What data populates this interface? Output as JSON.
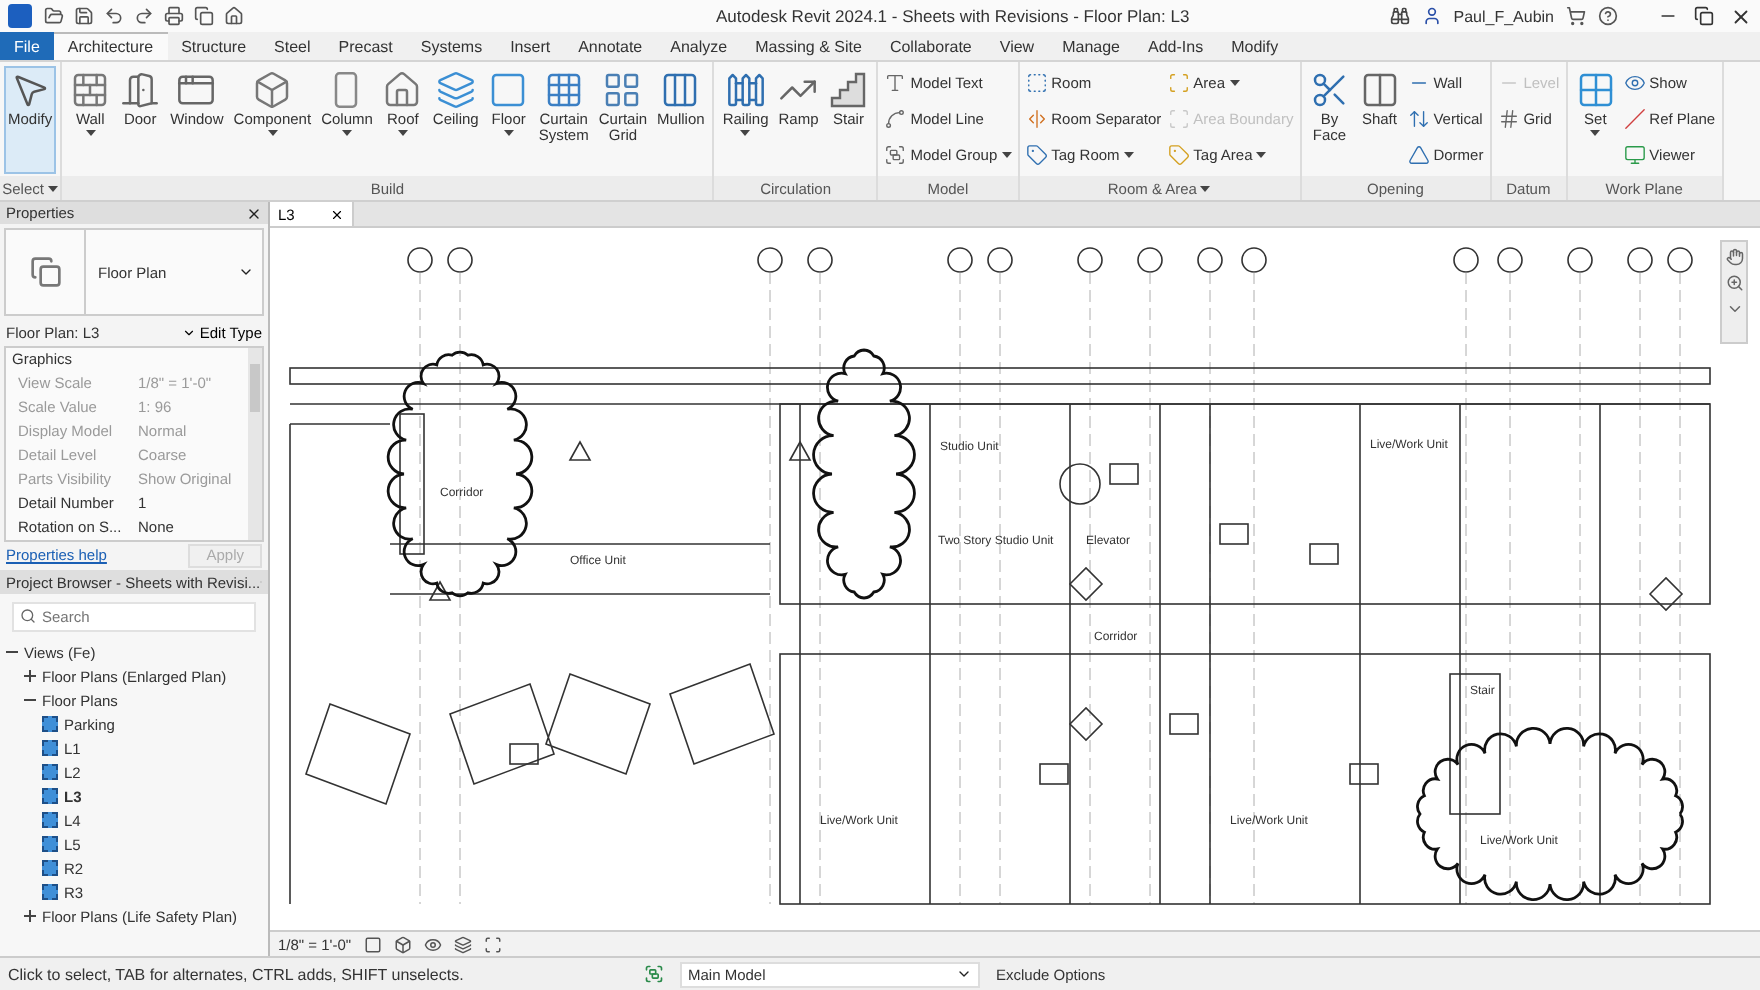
{
  "window": {
    "title": "Autodesk Revit 2024.1 - Sheets with Revisions - Floor Plan: L3",
    "user": "Paul_F_Aubin"
  },
  "tabs": [
    {
      "label": "File",
      "kind": "file",
      "selected": false
    },
    {
      "label": "Architecture",
      "kind": "tab",
      "selected": true
    },
    {
      "label": "Structure",
      "kind": "tab",
      "selected": false
    },
    {
      "label": "Steel",
      "kind": "tab",
      "selected": false
    },
    {
      "label": "Precast",
      "kind": "tab",
      "selected": false
    },
    {
      "label": "Systems",
      "kind": "tab",
      "selected": false
    },
    {
      "label": "Insert",
      "kind": "tab",
      "selected": false
    },
    {
      "label": "Annotate",
      "kind": "tab",
      "selected": false
    },
    {
      "label": "Analyze",
      "kind": "tab",
      "selected": false
    },
    {
      "label": "Massing & Site",
      "kind": "tab",
      "selected": false
    },
    {
      "label": "Collaborate",
      "kind": "tab",
      "selected": false
    },
    {
      "label": "View",
      "kind": "tab",
      "selected": false
    },
    {
      "label": "Manage",
      "kind": "tab",
      "selected": false
    },
    {
      "label": "Add-Ins",
      "kind": "tab",
      "selected": false
    },
    {
      "label": "Modify",
      "kind": "tab",
      "selected": false
    }
  ],
  "ribbon_panels": [
    {
      "label": "Select",
      "dropdown": true,
      "tools": [
        {
          "label": "Modify",
          "kind": "large",
          "selected": true,
          "disabled": false,
          "dropdown": false
        }
      ]
    },
    {
      "label": "Build",
      "dropdown": false,
      "tools": [
        {
          "label": "Wall",
          "kind": "large",
          "selected": false,
          "disabled": false,
          "dropdown": true
        },
        {
          "label": "Door",
          "kind": "large",
          "selected": false,
          "disabled": false,
          "dropdown": false
        },
        {
          "label": "Window",
          "kind": "large",
          "selected": false,
          "disabled": false,
          "dropdown": false
        },
        {
          "label": "Component",
          "kind": "large",
          "selected": false,
          "disabled": false,
          "dropdown": true
        },
        {
          "label": "Column",
          "kind": "large",
          "selected": false,
          "disabled": false,
          "dropdown": true
        },
        {
          "label": "Roof",
          "kind": "large",
          "selected": false,
          "disabled": false,
          "dropdown": true
        },
        {
          "label": "Ceiling",
          "kind": "large",
          "selected": false,
          "disabled": false,
          "dropdown": false
        },
        {
          "label": "Floor",
          "kind": "large",
          "selected": false,
          "disabled": false,
          "dropdown": true
        },
        {
          "label": "Curtain System",
          "kind": "large",
          "selected": false,
          "disabled": false,
          "dropdown": false
        },
        {
          "label": "Curtain Grid",
          "kind": "large",
          "selected": false,
          "disabled": false,
          "dropdown": false
        },
        {
          "label": "Mullion",
          "kind": "large",
          "selected": false,
          "disabled": false,
          "dropdown": false
        }
      ]
    },
    {
      "label": "Circulation",
      "dropdown": false,
      "tools": [
        {
          "label": "Railing",
          "kind": "large",
          "selected": false,
          "disabled": false,
          "dropdown": true
        },
        {
          "label": "Ramp",
          "kind": "large",
          "selected": false,
          "disabled": false,
          "dropdown": false
        },
        {
          "label": "Stair",
          "kind": "large",
          "selected": false,
          "disabled": false,
          "dropdown": false
        }
      ]
    },
    {
      "label": "Model",
      "dropdown": false,
      "tools": [
        {
          "label": "Model Text",
          "kind": "small",
          "selected": false,
          "disabled": false,
          "dropdown": false
        },
        {
          "label": "Model Line",
          "kind": "small",
          "selected": false,
          "disabled": false,
          "dropdown": false
        },
        {
          "label": "Model Group",
          "kind": "small",
          "selected": false,
          "disabled": false,
          "dropdown": true
        }
      ]
    },
    {
      "label": "Room & Area",
      "dropdown": true,
      "tools": [
        {
          "label": "Room",
          "kind": "small",
          "selected": false,
          "disabled": false,
          "dropdown": false
        },
        {
          "label": "Room Separator",
          "kind": "small",
          "selected": false,
          "disabled": false,
          "dropdown": false
        },
        {
          "label": "Tag Room",
          "kind": "small",
          "selected": false,
          "disabled": false,
          "dropdown": true
        },
        {
          "label": "Area",
          "kind": "small",
          "selected": false,
          "disabled": false,
          "dropdown": true
        },
        {
          "label": "Area Boundary",
          "kind": "small",
          "selected": false,
          "disabled": true,
          "dropdown": false
        },
        {
          "label": "Tag Area",
          "kind": "small",
          "selected": false,
          "disabled": false,
          "dropdown": true
        }
      ]
    },
    {
      "label": "Opening",
      "dropdown": false,
      "tools": [
        {
          "label": "By Face",
          "kind": "large",
          "selected": false,
          "disabled": false,
          "dropdown": false
        },
        {
          "label": "Shaft",
          "kind": "large",
          "selected": false,
          "disabled": false,
          "dropdown": false
        },
        {
          "label": "Wall",
          "kind": "small",
          "selected": false,
          "disabled": false,
          "dropdown": false
        },
        {
          "label": "Vertical",
          "kind": "small",
          "selected": false,
          "disabled": false,
          "dropdown": false
        },
        {
          "label": "Dormer",
          "kind": "small",
          "selected": false,
          "disabled": false,
          "dropdown": false
        }
      ]
    },
    {
      "label": "Datum",
      "dropdown": false,
      "tools": [
        {
          "label": "Level",
          "kind": "small",
          "selected": false,
          "disabled": true,
          "dropdown": false
        },
        {
          "label": "Grid",
          "kind": "small",
          "selected": false,
          "disabled": false,
          "dropdown": false
        }
      ]
    },
    {
      "label": "Work Plane",
      "dropdown": false,
      "tools": [
        {
          "label": "Set",
          "kind": "large",
          "selected": false,
          "disabled": false,
          "dropdown": true
        },
        {
          "label": "Show",
          "kind": "small",
          "selected": false,
          "disabled": false,
          "dropdown": false
        },
        {
          "label": "Ref Plane",
          "kind": "small",
          "selected": false,
          "disabled": false,
          "dropdown": false
        },
        {
          "label": "Viewer",
          "kind": "small",
          "selected": false,
          "disabled": false,
          "dropdown": false
        }
      ]
    }
  ],
  "properties": {
    "title": "Properties",
    "type": "Floor Plan",
    "instance": "Floor Plan: L3",
    "edit_type": "Edit Type",
    "group": "Graphics",
    "rows": [
      {
        "label": "View Scale",
        "value": "1/8\" = 1'-0\"",
        "disabled": true
      },
      {
        "label": "Scale Value",
        "value": "1: 96",
        "disabled": true
      },
      {
        "label": "Display Model",
        "value": "Normal",
        "disabled": true
      },
      {
        "label": "Detail Level",
        "value": "Coarse",
        "disabled": true
      },
      {
        "label": "Parts Visibility",
        "value": "Show Original",
        "disabled": true
      },
      {
        "label": "Detail Number",
        "value": "1",
        "disabled": false
      },
      {
        "label": "Rotation on S...",
        "value": "None",
        "disabled": false
      }
    ],
    "help": "Properties help",
    "apply": "Apply",
    "apply_disabled": true
  },
  "project_browser": {
    "title": "Project Browser - Sheets with Revisi...",
    "placeholder": "Search",
    "tree": [
      {
        "label": "Views (Fe)",
        "expanded": true,
        "selected": false,
        "children": [
          {
            "label": "Floor Plans (Enlarged Plan)",
            "expanded": false,
            "selected": false
          },
          {
            "label": "Floor Plans",
            "expanded": true,
            "selected": false,
            "children": [
              {
                "label": "Parking",
                "selected": false
              },
              {
                "label": "L1",
                "selected": false
              },
              {
                "label": "L2",
                "selected": false
              },
              {
                "label": "L3",
                "selected": true
              },
              {
                "label": "L4",
                "selected": false
              },
              {
                "label": "L5",
                "selected": false
              },
              {
                "label": "R2",
                "selected": false
              },
              {
                "label": "R3",
                "selected": false
              }
            ]
          },
          {
            "label": "Floor Plans (Life Safety Plan)",
            "expanded": false,
            "selected": false
          }
        ]
      }
    ]
  },
  "view": {
    "tab": "L3",
    "scale": "1/8\" = 1'-0\"",
    "rooms": [
      {
        "label": "Corridor"
      },
      {
        "label": "Office Unit"
      },
      {
        "label": "Studio Unit"
      },
      {
        "label": "Two Story Studio Unit"
      },
      {
        "label": "Elevator"
      },
      {
        "label": "Live/Work Unit"
      },
      {
        "label": "Corridor"
      },
      {
        "label": "Live/Work Unit"
      },
      {
        "label": "Live/Work Unit"
      },
      {
        "label": "Live/Work Unit"
      },
      {
        "label": "Stair"
      }
    ]
  },
  "status_bar": {
    "message": "Click to select, TAB for alternates, CTRL adds, SHIFT unselects.",
    "model": "Main Model",
    "exclude": "Exclude Options"
  }
}
